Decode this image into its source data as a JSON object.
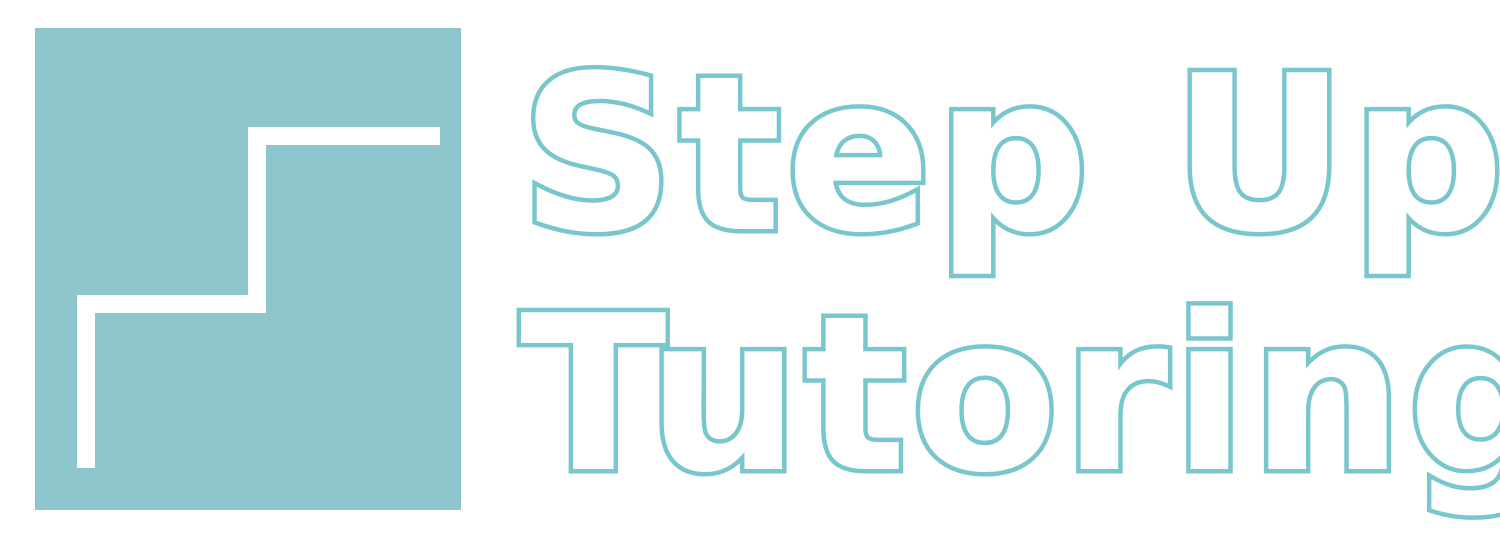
{
  "brand": {
    "name_line_1": "Step Up",
    "name_line_2": "Tutoring",
    "colors": {
      "logo_square": "#8dc6cc",
      "stair_line": "#ffffff",
      "wordmark_outline": "#7ac6cd",
      "wordmark_fill": "#ffffff",
      "background": "#ffffff"
    },
    "mark_icon": "stairs-icon"
  }
}
